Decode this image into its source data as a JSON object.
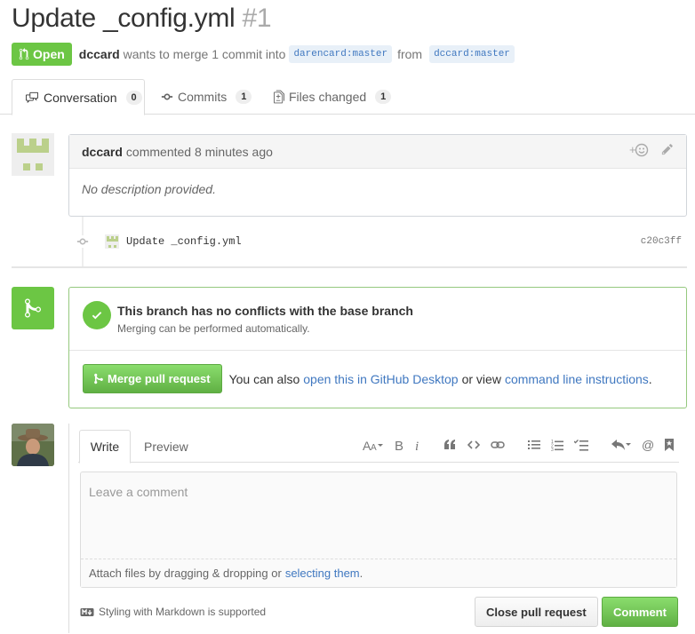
{
  "pr": {
    "title": "Update _config.yml",
    "number": "#1",
    "state": "Open",
    "author": "dccard",
    "summary": "wants to merge 1 commit into",
    "base_ref": "darencard:master",
    "from_text": "from",
    "head_ref": "dccard:master"
  },
  "tabs": [
    {
      "label": "Conversation",
      "count": "0"
    },
    {
      "label": "Commits",
      "count": "1"
    },
    {
      "label": "Files changed",
      "count": "1"
    }
  ],
  "comment": {
    "author": "dccard",
    "meta": "commented 8 minutes ago",
    "body": "No description provided."
  },
  "commit": {
    "message": "Update _config.yml",
    "sha": "c20c3ff"
  },
  "merge": {
    "heading": "This branch has no conflicts with the base branch",
    "subtext": "Merging can be performed automatically.",
    "button": "Merge pull request",
    "also_text": "You can also",
    "desktop_link": "open this in GitHub Desktop",
    "or_view": "or view",
    "cli_link": "command line instructions",
    "period": "."
  },
  "compose": {
    "tab_write": "Write",
    "tab_preview": "Preview",
    "placeholder": "Leave a comment",
    "attach_text": "Attach files by dragging & dropping or",
    "attach_link": "selecting them",
    "attach_period": ".",
    "markdown_note": "Styling with Markdown is supported",
    "close_button": "Close pull request",
    "comment_button": "Comment"
  },
  "colors": {
    "open_green": "#6cc644",
    "link_blue": "#4078c0"
  }
}
